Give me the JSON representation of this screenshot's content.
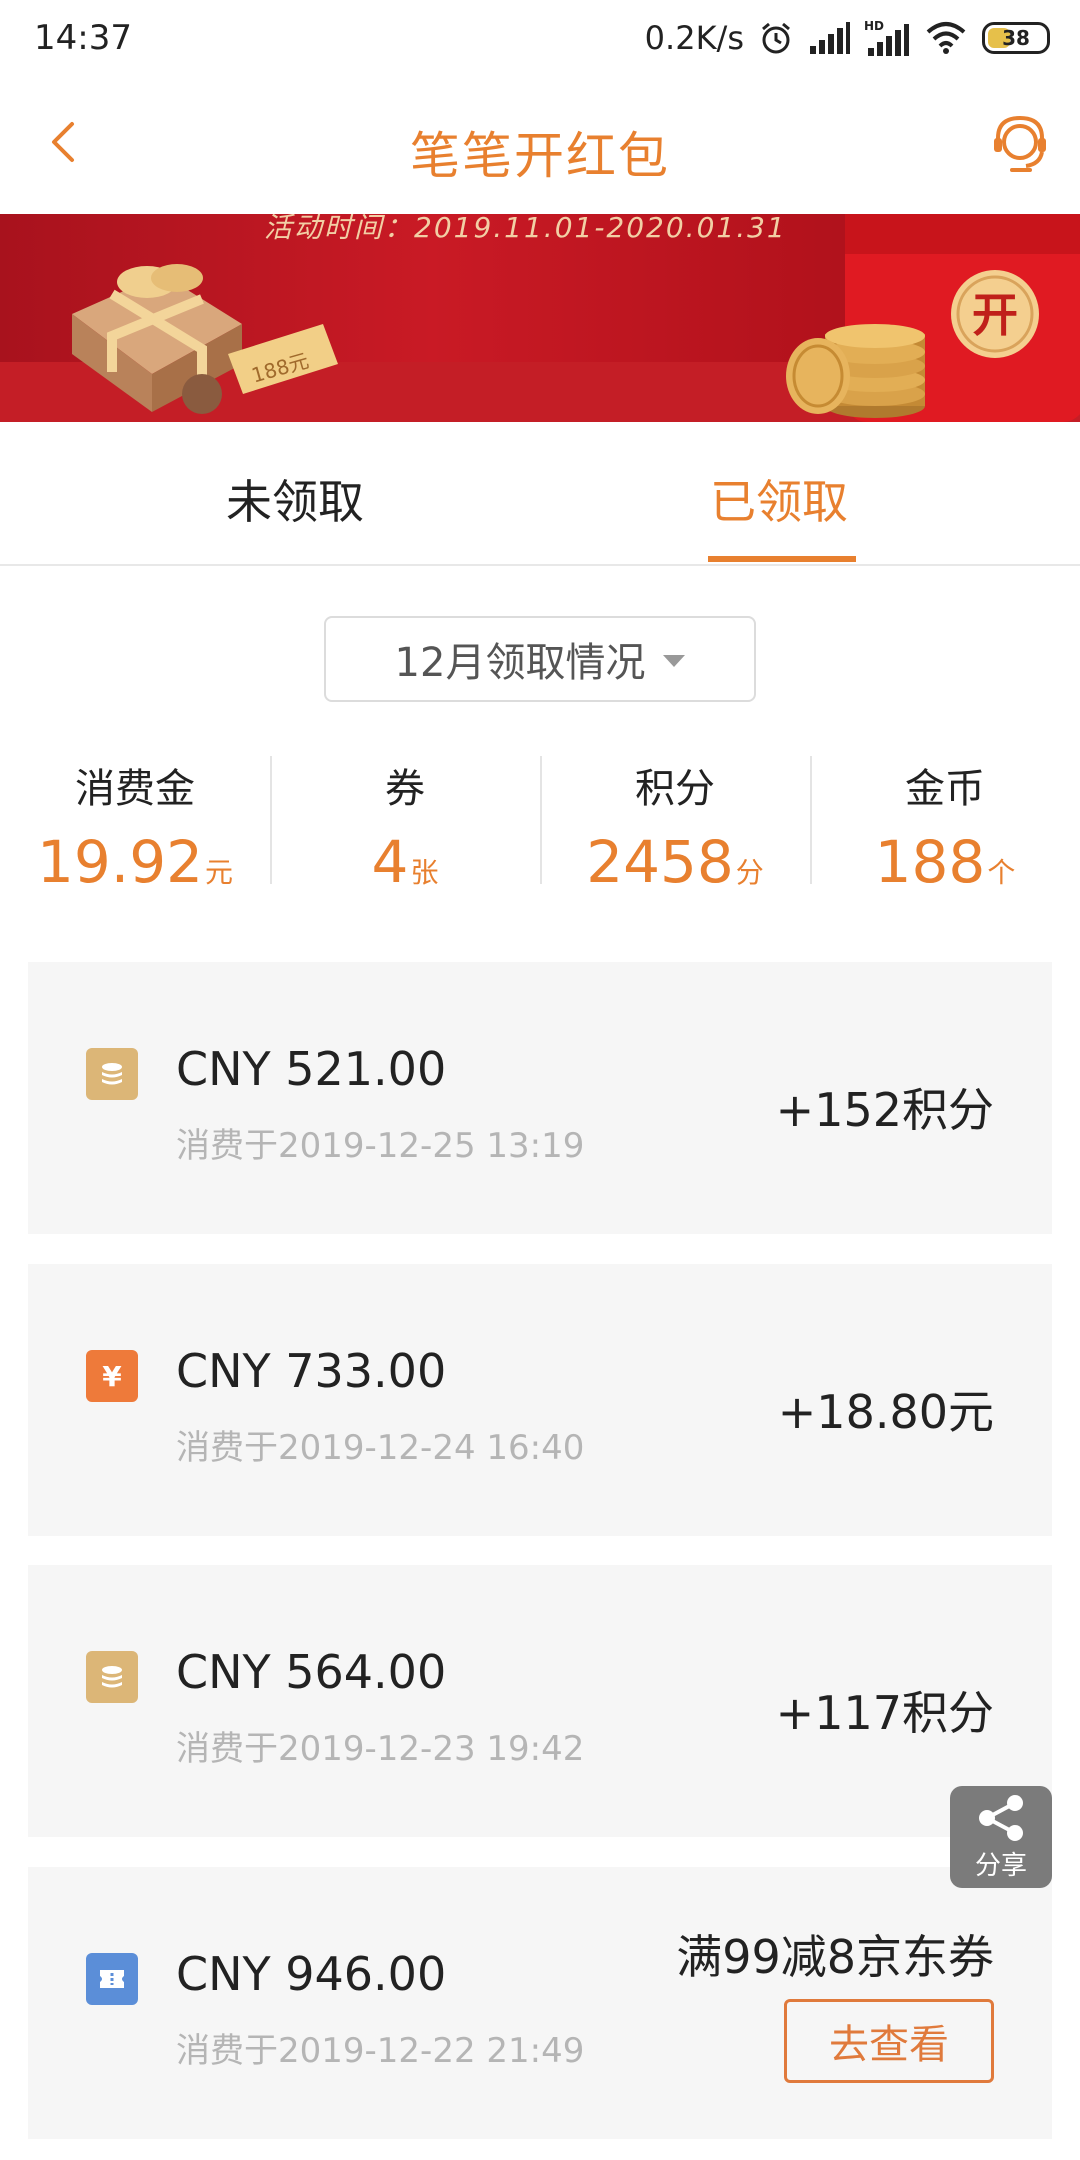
{
  "status_bar": {
    "time": "14:37",
    "net_speed": "0.2K/s",
    "battery": "38",
    "icons": [
      "alarm-icon",
      "signal-icon",
      "hd-signal-icon",
      "wifi-icon",
      "battery-icon"
    ]
  },
  "header": {
    "title": "笔笔开红包",
    "back_icon": "chevron-left-icon",
    "service_icon": "customer-service-icon"
  },
  "banner": {
    "activity_text": "活动时间：2019.11.01-2020.01.31",
    "coupon_tag": "188元",
    "packet_char": "开"
  },
  "tabs": {
    "unclaimed": "未领取",
    "claimed": "已领取",
    "active": "claimed"
  },
  "month_select": {
    "label": "12月领取情况"
  },
  "summary": [
    {
      "label": "消费金",
      "value": "19.92",
      "unit": "元"
    },
    {
      "label": "券",
      "value": "4",
      "unit": "张"
    },
    {
      "label": "积分",
      "value": "2458",
      "unit": "分"
    },
    {
      "label": "金币",
      "value": "188",
      "unit": "个"
    }
  ],
  "records": [
    {
      "icon": "coins-icon",
      "amount": "CNY 521.00",
      "date": "消费于2019-12-25 13:19",
      "reward": "+152积分"
    },
    {
      "icon": "yuan-icon",
      "amount": "CNY 733.00",
      "date": "消费于2019-12-24 16:40",
      "reward": "+18.80元"
    },
    {
      "icon": "coins-icon",
      "amount": "CNY 564.00",
      "date": "消费于2019-12-23 19:42",
      "reward": "+117积分"
    },
    {
      "icon": "ticket-icon",
      "amount": "CNY 946.00",
      "date": "消费于2019-12-22 21:49",
      "reward": "满99减8京东券",
      "button": "去查看"
    }
  ],
  "share": {
    "label": "分享"
  },
  "colors": {
    "accent": "#e8802f",
    "banner_red": "#c91a25",
    "card_bg": "#f6f6f6",
    "muted_text": "#b5b5b5"
  }
}
